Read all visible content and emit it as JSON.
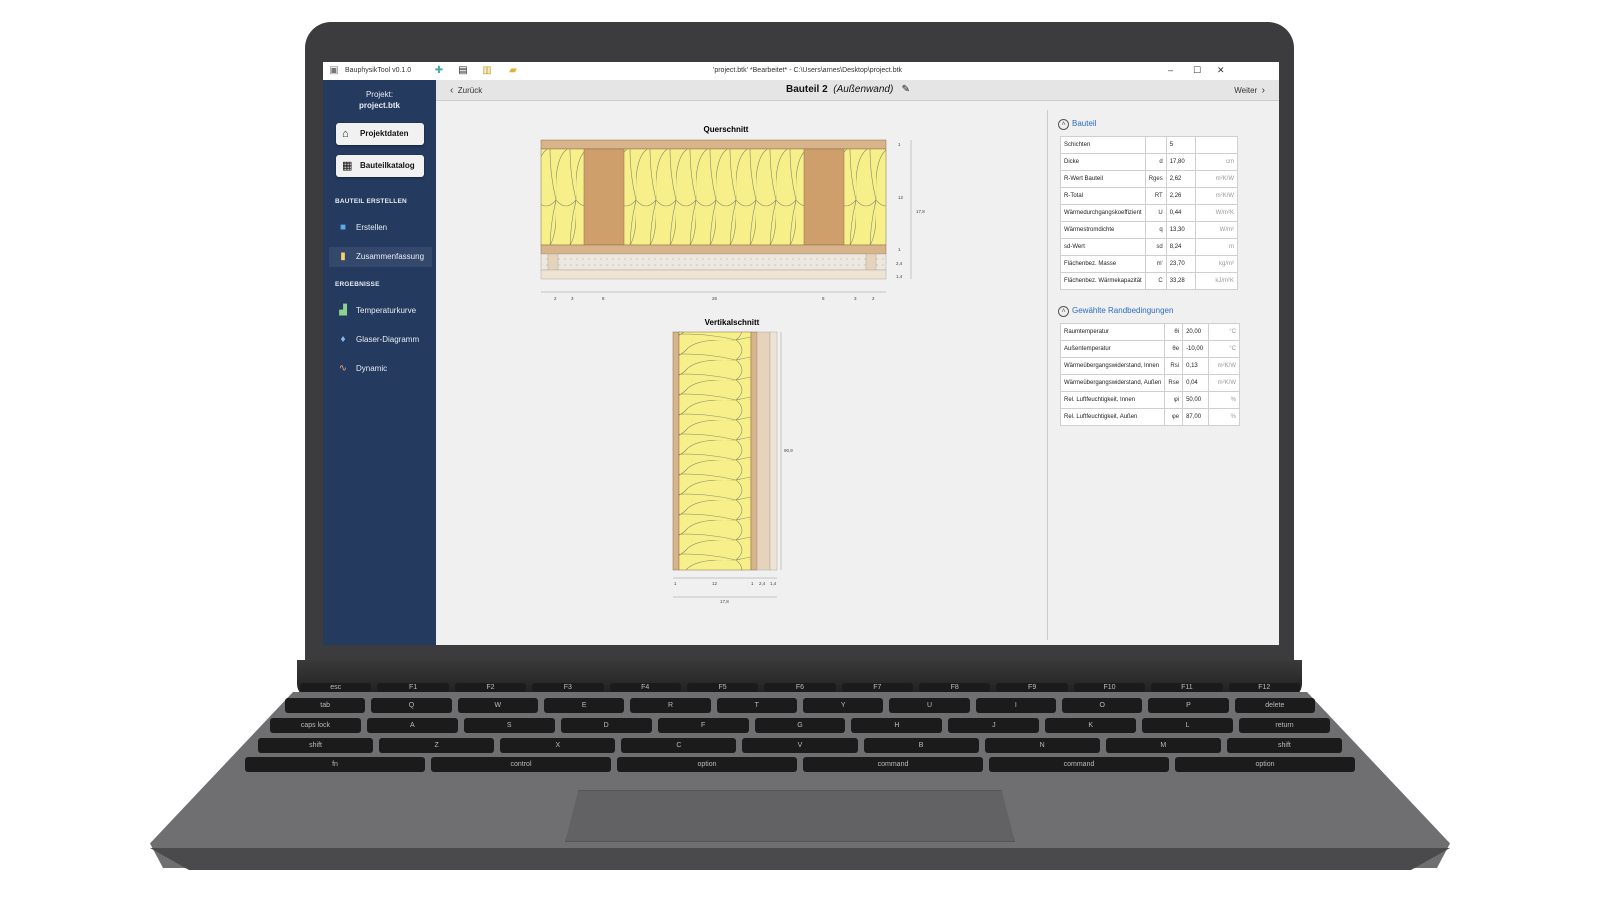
{
  "window": {
    "app_name": "BauphysikTool v0.1.0",
    "doc_title": "'project.btk' *Bearbeitet* - C:\\Users\\arnes\\Desktop\\project.btk",
    "minimize_icon": "minimize-icon",
    "maximize_icon": "maximize-icon",
    "close_icon": "close-icon"
  },
  "sidebar": {
    "project_label": "Projekt:",
    "project_name": "project.btk",
    "projektdaten": "Projektdaten",
    "bauteilkatalog": "Bauteilkatalog",
    "section_create": "BAUTEIL ERSTELLEN",
    "erstellen": "Erstellen",
    "zusammenfassung": "Zusammenfassung",
    "section_results": "ERGEBNISSE",
    "temperaturkurve": "Temperaturkurve",
    "glaser": "Glaser-Diagramm",
    "dynamic": "Dynamic"
  },
  "header": {
    "back": "Zurück",
    "title": "Bauteil 2",
    "subtitle": "(Außenwand)",
    "next": "Weiter"
  },
  "drawing": {
    "cross_title": "Querschnitt",
    "vertical_title": "Vertikalschnitt",
    "cross_dims_bottom": [
      "2",
      "3",
      "8",
      "26",
      "8",
      "3",
      "2"
    ],
    "cross_dims_right": [
      "1",
      "12",
      "1",
      "2,4",
      "1,4"
    ],
    "cross_total": "17,8",
    "vert_dims_bottom": [
      "1",
      "12",
      "1",
      "2,4",
      "1,4"
    ],
    "vert_total": "17,8",
    "vert_height": "90,9"
  },
  "bauteil": {
    "title": "Bauteil",
    "rows": [
      {
        "label": "Schichten",
        "sym": "",
        "value": "5",
        "unit": ""
      },
      {
        "label": "Dicke",
        "sym": "d",
        "value": "17,80",
        "unit": "cm"
      },
      {
        "label": "R-Wert Bauteil",
        "sym": "Rges",
        "value": "2,62",
        "unit": "m²K/W"
      },
      {
        "label": "R-Total",
        "sym": "RT",
        "value": "2,26",
        "unit": "m²K/W"
      },
      {
        "label": "Wärmedurchgangskoeffizient",
        "sym": "U",
        "value": "0,44",
        "unit": "W/m²K"
      },
      {
        "label": "Wärmestromdichte",
        "sym": "q",
        "value": "13,30",
        "unit": "W/m²"
      },
      {
        "label": "sd-Wert",
        "sym": "sd",
        "value": "8,24",
        "unit": "m"
      },
      {
        "label": "Flächenbez. Masse",
        "sym": "m'",
        "value": "23,70",
        "unit": "kg/m²"
      },
      {
        "label": "Flächenbez. Wärmekapazität",
        "sym": "C",
        "value": "33,28",
        "unit": "kJ/m²K"
      }
    ]
  },
  "rand": {
    "title": "Gewählte Randbedingungen",
    "rows": [
      {
        "label": "Raumtemperatur",
        "sym": "θi",
        "value": "20,00",
        "unit": "°C"
      },
      {
        "label": "Außentemperatur",
        "sym": "θe",
        "value": "-10,00",
        "unit": "°C"
      },
      {
        "label": "Wärmeübergangswiderstand, Innen",
        "sym": "Rsi",
        "value": "0,13",
        "unit": "m²K/W"
      },
      {
        "label": "Wärmeübergangswiderstand, Außen",
        "sym": "Rse",
        "value": "0,04",
        "unit": "m²K/W"
      },
      {
        "label": "Rel. Luftfeuchtigkeit, Innen",
        "sym": "φi",
        "value": "50,00",
        "unit": "%"
      },
      {
        "label": "Rel. Luftfeuchtigkeit, Außen",
        "sym": "φe",
        "value": "87,00",
        "unit": "%"
      }
    ]
  },
  "keyboard": {
    "row1": [
      "esc",
      "F1",
      "F2",
      "F3",
      "F4",
      "F5",
      "F6",
      "F7",
      "F8",
      "F9",
      "F10",
      "F11",
      "F12"
    ],
    "row2": [
      "tab",
      "Q",
      "W",
      "E",
      "R",
      "T",
      "Y",
      "U",
      "I",
      "O",
      "P",
      "delete"
    ],
    "row3": [
      "caps lock",
      "A",
      "S",
      "D",
      "F",
      "G",
      "H",
      "J",
      "K",
      "L",
      "return"
    ],
    "row4": [
      "shift",
      "Z",
      "X",
      "C",
      "V",
      "B",
      "N",
      "M",
      "shift"
    ],
    "row5": [
      "fn",
      "control",
      "option",
      "command",
      "command",
      "option"
    ]
  },
  "colors": {
    "sidebar": "#243a5e",
    "insulation": "#f6ef8a",
    "wood": "#d2a679",
    "accent": "#2b6cc4"
  }
}
